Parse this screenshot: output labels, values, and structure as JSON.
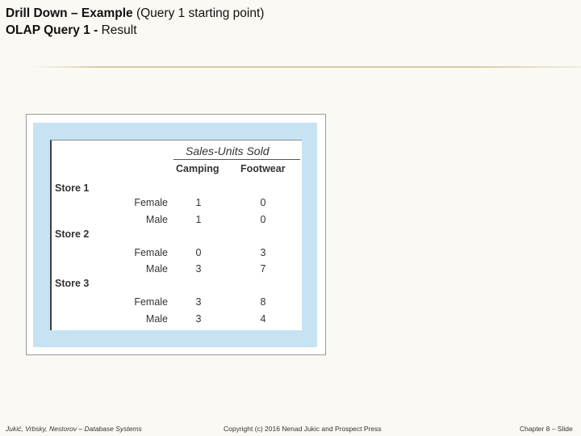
{
  "title": {
    "line1_bold": "Drill Down – Example",
    "line1_rest": " (Query 1 starting point)",
    "line2_bold": "OLAP Query 1 -",
    "line2_rest": " Result"
  },
  "table": {
    "measure_title": "Sales-Units Sold",
    "columns": [
      "Camping",
      "Footwear"
    ],
    "stores": [
      {
        "label": "Store 1",
        "rows": [
          {
            "gender": "Female",
            "values": [
              "1",
              "0"
            ]
          },
          {
            "gender": "Male",
            "values": [
              "1",
              "0"
            ]
          }
        ]
      },
      {
        "label": "Store 2",
        "rows": [
          {
            "gender": "Female",
            "values": [
              "0",
              "3"
            ]
          },
          {
            "gender": "Male",
            "values": [
              "3",
              "7"
            ]
          }
        ]
      },
      {
        "label": "Store 3",
        "rows": [
          {
            "gender": "Female",
            "values": [
              "3",
              "8"
            ]
          },
          {
            "gender": "Male",
            "values": [
              "3",
              "4"
            ]
          }
        ]
      }
    ]
  },
  "footer": {
    "left": "Jukić, Vrbsky, Nestorov – Database Systems",
    "middle": "Copyright (c) 2016 Nenad Jukic and Prospect Press",
    "right": "Chapter 8 – Slide"
  }
}
